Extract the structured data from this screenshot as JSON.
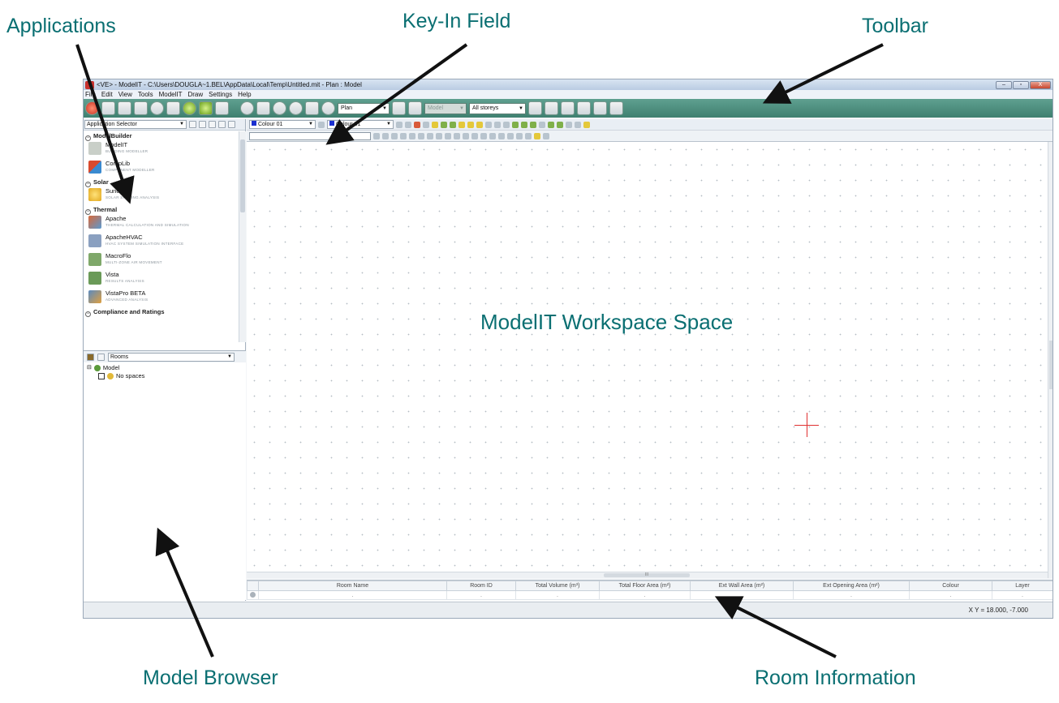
{
  "callouts": {
    "applications": "Applications",
    "keyin": "Key-In Field",
    "toolbar": "Toolbar",
    "workspace": "ModelIT Workspace Space",
    "model_browser": "Model Browser",
    "room_information": "Room Information"
  },
  "window": {
    "title": "<VE> - ModelIT - C:\\Users\\DOUGLA~1.BEL\\AppData\\Local\\Temp\\Untitled.mit - Plan : Model",
    "controls": [
      "–",
      "▫",
      "X"
    ]
  },
  "menu": [
    "File",
    "Edit",
    "View",
    "Tools",
    "ModelIT",
    "Draw",
    "Settings",
    "Help"
  ],
  "toolbar": {
    "view_select": "Plan",
    "model_select": "Model",
    "storeys_select": "All storeys"
  },
  "app_selector": {
    "label": "Application Selector",
    "groups": [
      {
        "name": "ModelBuilder",
        "items": [
          {
            "name": "ModelIT",
            "sub": "BUILDING MODELLER",
            "color": "#c9cfc8"
          },
          {
            "name": "CompLib",
            "sub": "COMPONENT MODELLER",
            "color": "#d94a2e"
          }
        ]
      },
      {
        "name": "Solar",
        "items": [
          {
            "name": "Suncast",
            "sub": "SOLAR SHADING ANALYSIS",
            "color": "#f0c22a"
          }
        ]
      },
      {
        "name": "Thermal",
        "items": [
          {
            "name": "Apache",
            "sub": "THERMAL CALCULATION AND SIMULATION",
            "color": "#d9693a"
          },
          {
            "name": "ApacheHVAC",
            "sub": "HVAC SYSTEM SIMULATION INTERFACE",
            "color": "#8aa0c0"
          },
          {
            "name": "MacroFlo",
            "sub": "MULTI-ZONE AIR MOVEMENT",
            "color": "#7fa86a"
          },
          {
            "name": "Vista",
            "sub": "RESULTS ANALYSIS",
            "color": "#6a9a58"
          },
          {
            "name": "VistaPro BETA",
            "sub": "ADVANCED ANALYSIS",
            "color": "#5a8ac0"
          }
        ]
      },
      {
        "name": "Compliance and Ratings",
        "items": []
      }
    ]
  },
  "colour_select": {
    "first": "Colour 01",
    "second": "Colour 01"
  },
  "browser": {
    "view_select": "Rooms",
    "root": "Model",
    "child": "No spaces"
  },
  "room_table": {
    "headers": [
      "Room Name",
      "Room ID",
      "Total Volume (m³)",
      "Total Floor Area (m²)",
      "Ext Wall Area (m²)",
      "Ext Opening Area (m²)",
      "Colour",
      "Layer"
    ],
    "row": [
      ".",
      ".",
      ".",
      ".",
      ".",
      ".",
      ".",
      "."
    ]
  },
  "status": {
    "coords": "X Y = 18.000, -7.000"
  },
  "hscroll_label": "III"
}
